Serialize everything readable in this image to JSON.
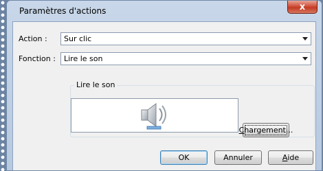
{
  "window": {
    "title": "Paramètres d'actions",
    "close_glyph": "x"
  },
  "action_row": {
    "label": "Action :",
    "value": "Sur clic"
  },
  "function_row": {
    "label": "Fonction :",
    "value": "Lire le son"
  },
  "sound_group": {
    "title": "Lire le son",
    "icon": "speaker-note-icon",
    "load_button": {
      "accel": "C",
      "rest": "hargement..."
    }
  },
  "footer": {
    "ok_label": "OK",
    "cancel_label": "Annuler",
    "help_button": {
      "accel": "A",
      "rest": "ide"
    }
  },
  "colors": {
    "desktop": "#6c84a2",
    "frame": "#b7c9e0",
    "client": "#f0f0f0",
    "close": "#c33b24"
  }
}
